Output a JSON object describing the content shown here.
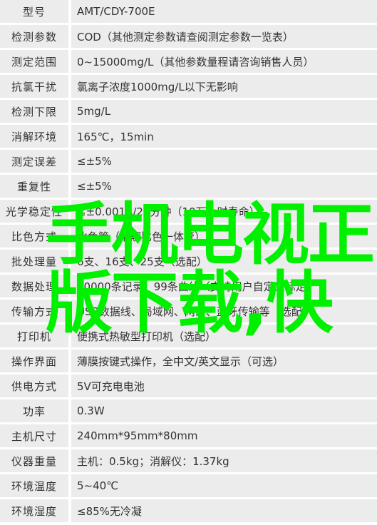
{
  "specs": [
    {
      "label": "型号",
      "value": "AMT/CDY-700E"
    },
    {
      "label": "检测参数",
      "value": "COD（其他测定参数请查阅测定参数一览表）"
    },
    {
      "label": "测定范围",
      "value": "0~15000mg/L（其他参数量程请咨询销售人员）"
    },
    {
      "label": "抗氯干扰",
      "value": "氯离子浓度1000mg/L以下无影响"
    },
    {
      "label": "检测下限",
      "value": "5mg/L"
    },
    {
      "label": "消解环境",
      "value": "165℃，15min"
    },
    {
      "label": "测定误差",
      "value": "≤±5%"
    },
    {
      "label": "重复性",
      "value": "≤±5%"
    },
    {
      "label": "光学稳定性",
      "value": "≤±0.001A/20分钟（10万小时寿命）"
    },
    {
      "label": "比色方式",
      "value": "比色管（消解比色一体管）"
    },
    {
      "label": "批处理量",
      "value": "6支、16支、25支（选配）"
    },
    {
      "label": "数据处理",
      "value": "30000条记录、99条曲线（支持用户自定义标定）"
    },
    {
      "label": "传输方式",
      "value": "USB数据线、局域网、网口、蓝牙传输等（选配）"
    },
    {
      "label": "打印机",
      "value": "便携式热敏型打印机（选配）"
    },
    {
      "label": "操作界面",
      "value": "薄膜按键式操作，全中文/英文显示（可选）"
    },
    {
      "label": "供电方式",
      "value": "5V可充电电池"
    },
    {
      "label": "功率",
      "value": "0.3W"
    },
    {
      "label": "主机尺寸",
      "value": "240mm*95mm*80mm"
    },
    {
      "label": "仪器重量",
      "value": "主机：0.5kg；消解仪：1.37kg"
    },
    {
      "label": "环境温度",
      "value": "5~40℃"
    },
    {
      "label": "环境湿度",
      "value": "≤85%无冷凝"
    }
  ],
  "overlay": {
    "line1": "手机电视正",
    "line2": "版下载,快",
    "color": "#00f000"
  }
}
